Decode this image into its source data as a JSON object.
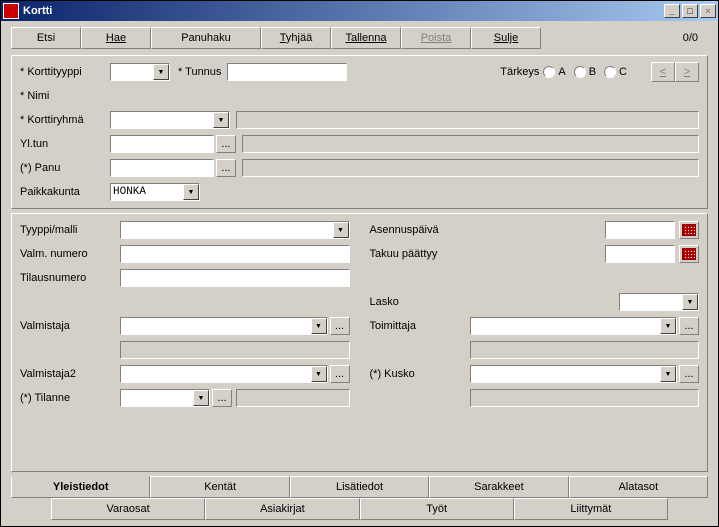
{
  "window": {
    "title": "Kortti"
  },
  "toolbar": {
    "etsi": "Etsi",
    "hae": "Hae",
    "panuhaku": "Panuhaku",
    "tyhja": "Tyhjää",
    "tallenna": "Tallenna",
    "poista": "Poista",
    "sulje": "Sulje",
    "counter": "0/0"
  },
  "fields": {
    "korttityyppi": "* Korttityyppi",
    "tunnus": "* Tunnus",
    "tarkeys": "Tärkeys",
    "tarkeysA": "A",
    "tarkeysB": "B",
    "tarkeysC": "C",
    "nimi": "* Nimi",
    "korttiryhma": "* Korttiryhmä",
    "yltun": "Yl.tun",
    "panu": "(*) Panu",
    "paikkakunta": "Paikkakunta",
    "paikkakunta_value": "HONKA"
  },
  "detail": {
    "tyyppimalli": "Tyyppi/malli",
    "valm_numero": "Valm. numero",
    "tilausnumero": "Tilausnumero",
    "valmistaja": "Valmistaja",
    "valmistaja2": "Valmistaja2",
    "tilanne": "(*) Tilanne",
    "asennuspaiva": "Asennuspäivä",
    "takuu_paattyy": "Takuu päättyy",
    "lasko": "Lasko",
    "toimittaja": "Toimittaja",
    "kusko": "(*) Kusko"
  },
  "tabs1": {
    "yleistiedot": "Yleistiedot",
    "kentat": "Kentät",
    "lisatiedot": "Lisätiedot",
    "sarakkeet": "Sarakkeet",
    "alatasot": "Alatasot"
  },
  "tabs2": {
    "varaosat": "Varaosat",
    "asiakirjat": "Asiakirjat",
    "tyot": "Työt",
    "liittymat": "Liittymät"
  },
  "nav": {
    "prev": "<",
    "next": ">"
  },
  "misc": {
    "ellipsis": "..."
  }
}
